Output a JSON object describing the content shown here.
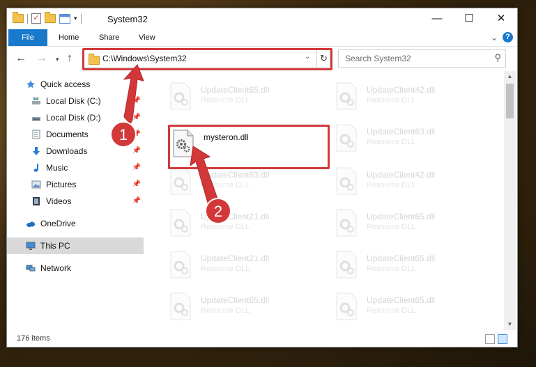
{
  "window": {
    "title": "System32",
    "controls": {
      "minimize": "—",
      "maximize": "☐",
      "close": "✕"
    }
  },
  "ribbon": {
    "tabs": [
      {
        "label": "File"
      },
      {
        "label": "Home"
      },
      {
        "label": "Share"
      },
      {
        "label": "View"
      }
    ]
  },
  "address": {
    "path": "C:\\Windows\\System32"
  },
  "search": {
    "placeholder": "Search System32"
  },
  "sidebar": {
    "items": [
      {
        "label": "Quick access",
        "icon": "star-icon"
      },
      {
        "label": "Local Disk (C:)",
        "icon": "drive-icon",
        "pinned": true
      },
      {
        "label": "Local Disk (D:)",
        "icon": "drive-icon",
        "pinned": true
      },
      {
        "label": "Documents",
        "icon": "documents-icon",
        "pinned": true
      },
      {
        "label": "Downloads",
        "icon": "download-icon",
        "pinned": true
      },
      {
        "label": "Music",
        "icon": "music-icon",
        "pinned": true
      },
      {
        "label": "Pictures",
        "icon": "pictures-icon",
        "pinned": true
      },
      {
        "label": "Videos",
        "icon": "videos-icon",
        "pinned": true
      },
      {
        "label": "OneDrive",
        "icon": "cloud-icon"
      },
      {
        "label": "This PC",
        "icon": "computer-icon",
        "selected": true
      },
      {
        "label": "Network",
        "icon": "network-icon"
      }
    ]
  },
  "files": {
    "left": [
      {
        "name": "UpdateClient65.dll",
        "type": "Resource DLL"
      },
      {
        "name": "mysteron.dll",
        "type": ""
      },
      {
        "name": "UpdateClient63.dll",
        "type": "Resource DLL"
      },
      {
        "name": "UpdateClient21.dll",
        "type": "Resource DLL"
      },
      {
        "name": "UpdateClient21.dll",
        "type": "Resource DLL"
      },
      {
        "name": "UpdateClient65.dll",
        "type": "Resource DLL"
      }
    ],
    "right": [
      {
        "name": "UpdateClient42.dll",
        "type": "Resource DLL"
      },
      {
        "name": "UpdateClient63.dll",
        "type": "Resource DLL"
      },
      {
        "name": "UpdateClient42.dll",
        "type": "Resource DLL"
      },
      {
        "name": "UpdateClient65.dll",
        "type": "Resource DLL"
      },
      {
        "name": "UpdateClient65.dll",
        "type": "Resource DLL"
      },
      {
        "name": "UpdateClient65.dll",
        "type": "Resource DLL"
      }
    ]
  },
  "status": {
    "item_count": "176 items"
  },
  "annotations": {
    "step1": "1",
    "step2": "2"
  },
  "colors": {
    "accent": "#1979ca",
    "highlight_red": "#d2383a"
  }
}
